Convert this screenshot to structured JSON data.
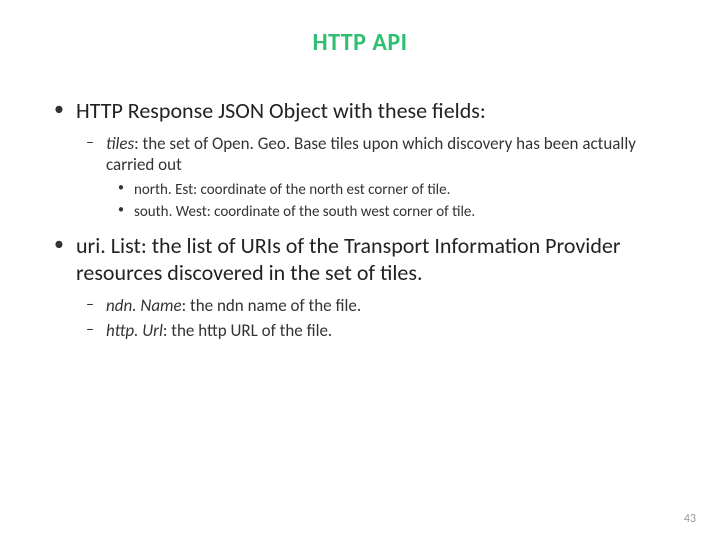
{
  "title": "HTTP API",
  "bullets": [
    {
      "text": "HTTP Response JSON Object with these fields:",
      "children": [
        {
          "text_italic": "tiles",
          "text_rest": ": the set of Open. Geo. Base tiles upon which discovery has been actually carried out",
          "children": [
            {
              "text": "north. Est: coordinate of the north est corner of tile."
            },
            {
              "text": "south. West: coordinate of the south west corner of tile."
            }
          ]
        }
      ]
    },
    {
      "text": "uri. List: the list of URIs of the Transport Information Provider resources discovered in the set of tiles.",
      "children": [
        {
          "text_italic": "ndn. Name",
          "text_rest": ": the ndn name of the file."
        },
        {
          "text_italic": "http. Url",
          "text_rest": ": the http URL of the file."
        }
      ]
    }
  ],
  "page_number": "43"
}
